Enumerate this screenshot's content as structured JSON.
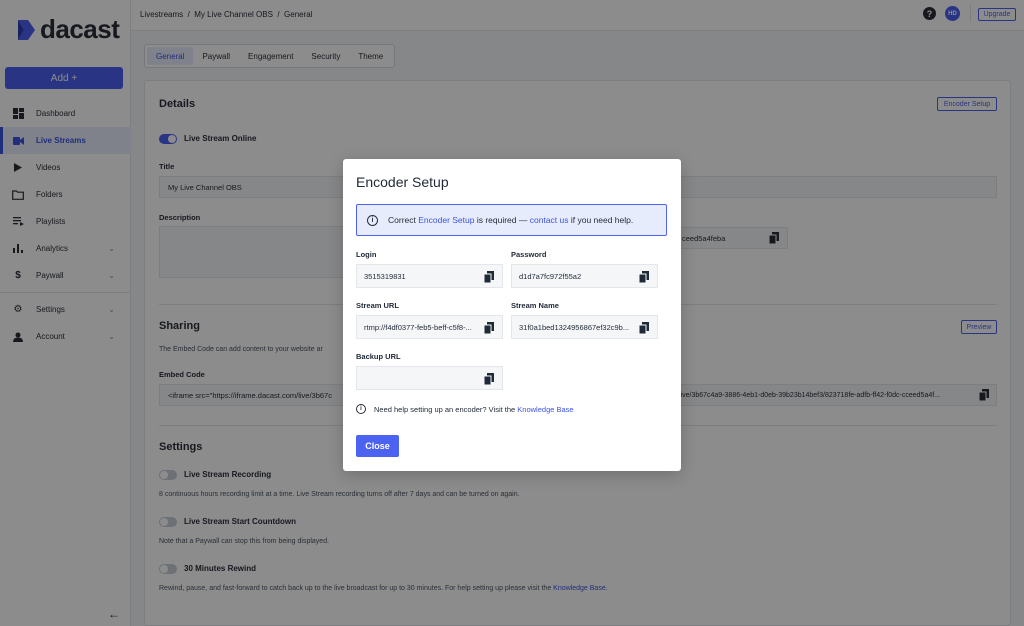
{
  "brand": {
    "name": "dacast",
    "accent": "#4c62f0"
  },
  "sidebar": {
    "add_label": "Add +",
    "items": [
      {
        "label": "Dashboard",
        "icon": "dashboard-icon"
      },
      {
        "label": "Live Streams",
        "icon": "video-camera-icon",
        "active": true
      },
      {
        "label": "Videos",
        "icon": "play-icon"
      },
      {
        "label": "Folders",
        "icon": "folder-icon"
      },
      {
        "label": "Playlists",
        "icon": "playlist-icon"
      },
      {
        "label": "Analytics",
        "icon": "bar-chart-icon"
      },
      {
        "label": "Paywall",
        "icon": "dollar-icon"
      },
      {
        "label": "Settings",
        "icon": "gear-icon"
      },
      {
        "label": "Account",
        "icon": "person-icon"
      }
    ]
  },
  "topbar": {
    "breadcrumb": "Livestreams  /  My Live Channel OBS  /  General",
    "help": "?",
    "avatar_initials": "HD",
    "upgrade_label": "Upgrade"
  },
  "tabs": [
    "General",
    "Paywall",
    "Engagement",
    "Security",
    "Theme"
  ],
  "details": {
    "heading": "Details",
    "encoder_setup_label": "Encoder Setup",
    "online_label": "Live Stream Online",
    "title_label": "Title",
    "title_value": "My Live Channel OBS",
    "description_label": "Description",
    "partial_id": "ceed5a4feba"
  },
  "sharing": {
    "heading": "Sharing",
    "preview_label": "Preview",
    "intro": "The Embed Code can add content to your website ar",
    "embed_label": "Embed Code",
    "embed_value_left": "<iframe src=\"https://iframe.dacast.com/live/3b67c",
    "embed_value_right": "live/3b67c4a9-3886-4eb1-d0eb-39b23b14bef3/823718fe-adfb-ff42-f0dc-cceed5a4f..."
  },
  "settings": {
    "heading": "Settings",
    "recording_label": "Live Stream Recording",
    "recording_note": "8 continuous hours recording limit at a time. Live Stream recording turns off after 7 days and can be turned on again.",
    "countdown_label": "Live Stream Start Countdown",
    "countdown_note": "Note that a Paywall can stop this from being displayed.",
    "rewind_label": "30 Minutes Rewind",
    "rewind_note": "Rewind, pause, and fast-forward to catch back up to the live broadcast for up to 30 minutes. For help setting up please visit the ",
    "rewind_link": "Knowledge Base",
    "rewind_end": "."
  },
  "modal": {
    "title": "Encoder Setup",
    "banner_pre": "Correct ",
    "banner_link1": "Encoder Setup",
    "banner_mid": " is required — ",
    "banner_link2": "contact us",
    "banner_post": " if you need help.",
    "login_label": "Login",
    "login_value": "3515319831",
    "password_label": "Password",
    "password_value": "d1d7a7fc972f55a2",
    "stream_url_label": "Stream URL",
    "stream_url_value": "rtmp://f4df0377-feb5-beff-c5f8-...",
    "stream_name_label": "Stream Name",
    "stream_name_value": "31f0a1bed1324956867ef32c9b...",
    "backup_url_label": "Backup URL",
    "backup_url_value": "",
    "help_text": "Need help setting up an encoder? Visit the ",
    "help_link": "Knowledge Base",
    "close_label": "Close"
  }
}
